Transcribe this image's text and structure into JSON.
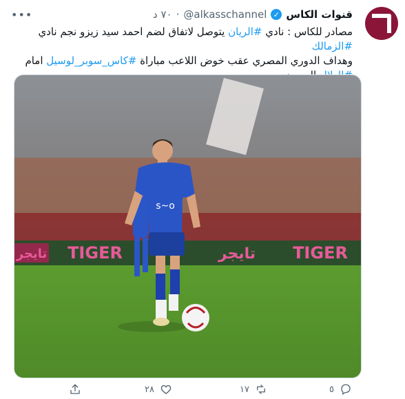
{
  "author": {
    "name": "قنوات الكاس",
    "handle": "@alkasschannel",
    "separator": "·",
    "time": "٧٠ د",
    "more_icon": "ellipsis-icon"
  },
  "tweet": {
    "line1_a": "مصادر للكاس : نادي ",
    "line1_tag1": "#الريان",
    "line1_b": " يتوصل لاتفاق لضم احمد سيد زيزو نجم نادي ",
    "line1_tag2": "#الزمالك",
    "line2_a": "وهداف الدوري المصري عقب خوض اللاعب مباراة ",
    "line2_tag": "#كاس_سوبر_لوسيل",
    "line2_b": " امام",
    "line3_tag": "#الهلال",
    "line3_b": " السعودي"
  },
  "image_text": {
    "ad_left": "تايجر",
    "ad_center_en": "TIGER",
    "ad_center_ar": "تايجر",
    "ad_right": "TIGER",
    "shirt_sponsor": "s~o"
  },
  "actions": {
    "reply_count": "٥",
    "retweet_count": "١٧",
    "like_count": "٢٨",
    "share_label": ""
  },
  "colors": {
    "accent": "#1d9bf0",
    "brand": "#8a1538",
    "muted": "#536471"
  }
}
